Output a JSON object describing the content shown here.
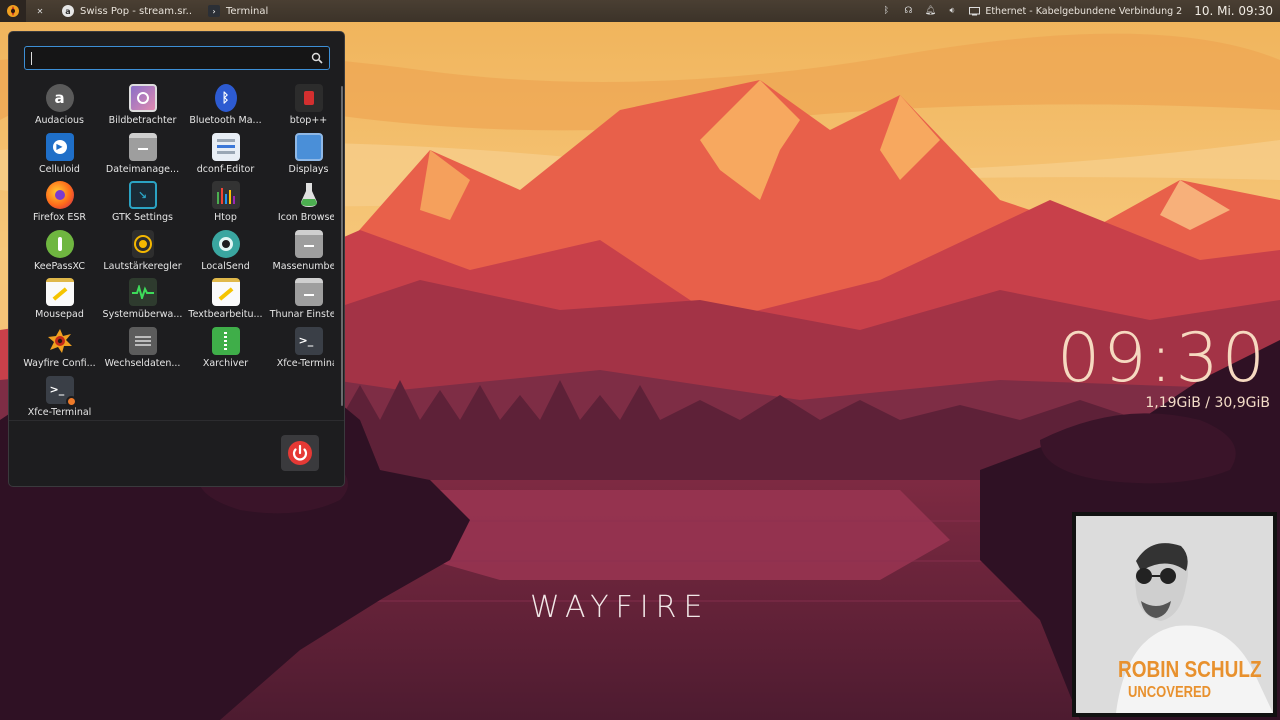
{
  "panel": {
    "tasks": [
      {
        "label": "Swiss Pop - stream.sr..",
        "icon": "audacious-icon"
      },
      {
        "label": "Terminal",
        "icon": "terminal-icon"
      }
    ],
    "tray": [
      "bluetooth-icon",
      "network-applet-icon",
      "notification-bell-icon",
      "volume-icon"
    ],
    "network_label": "Ethernet - Kabelgebundene Verbindung 2",
    "clock": "10. Mi. 09:30"
  },
  "menu": {
    "search_placeholder": "",
    "apps": [
      {
        "label": "Audacious",
        "icon": "audacious-icon"
      },
      {
        "label": "Bildbetrachter",
        "icon": "image-viewer-icon"
      },
      {
        "label": "Bluetooth Ma...",
        "icon": "bluetooth-icon"
      },
      {
        "label": "btop++",
        "icon": "btop-icon"
      },
      {
        "label": "Celluloid",
        "icon": "celluloid-icon"
      },
      {
        "label": "Dateimanage...",
        "icon": "file-manager-icon"
      },
      {
        "label": "dconf-Editor",
        "icon": "dconf-editor-icon"
      },
      {
        "label": "Displays",
        "icon": "displays-icon"
      },
      {
        "label": "Firefox ESR",
        "icon": "firefox-icon"
      },
      {
        "label": "GTK Settings",
        "icon": "gtk-settings-icon"
      },
      {
        "label": "Htop",
        "icon": "htop-icon"
      },
      {
        "label": "Icon Browser",
        "icon": "icon-browser-icon"
      },
      {
        "label": "KeePassXC",
        "icon": "keepassxc-icon"
      },
      {
        "label": "Lautstärkeregler",
        "icon": "volume-control-icon"
      },
      {
        "label": "LocalSend",
        "icon": "localsend-icon"
      },
      {
        "label": "Massenumbe...",
        "icon": "bulk-rename-icon"
      },
      {
        "label": "Mousepad",
        "icon": "mousepad-icon"
      },
      {
        "label": "Systemüberwa...",
        "icon": "system-monitor-icon"
      },
      {
        "label": "Textbearbeitu...",
        "icon": "text-editor-icon"
      },
      {
        "label": "Thunar Einstel...",
        "icon": "thunar-settings-icon"
      },
      {
        "label": "Wayfire Confi...",
        "icon": "wayfire-config-icon"
      },
      {
        "label": "Wechseldaten...",
        "icon": "removable-drives-icon"
      },
      {
        "label": "Xarchiver",
        "icon": "xarchiver-icon"
      },
      {
        "label": "Xfce-Terminal",
        "icon": "terminal-icon"
      },
      {
        "label": "Xfce-Terminal",
        "icon": "terminal-settings-icon"
      }
    ]
  },
  "desktop": {
    "clock": "09:30",
    "memory": "1,19GiB / 30,9GiB",
    "brand": "WAYFIRE"
  },
  "album": {
    "artist": "ROBIN SCHULZ",
    "title": "UNCOVERED"
  },
  "colors": {
    "accent": "#3d8fd6",
    "power": "#e53935",
    "album_text": "#e8912e"
  }
}
